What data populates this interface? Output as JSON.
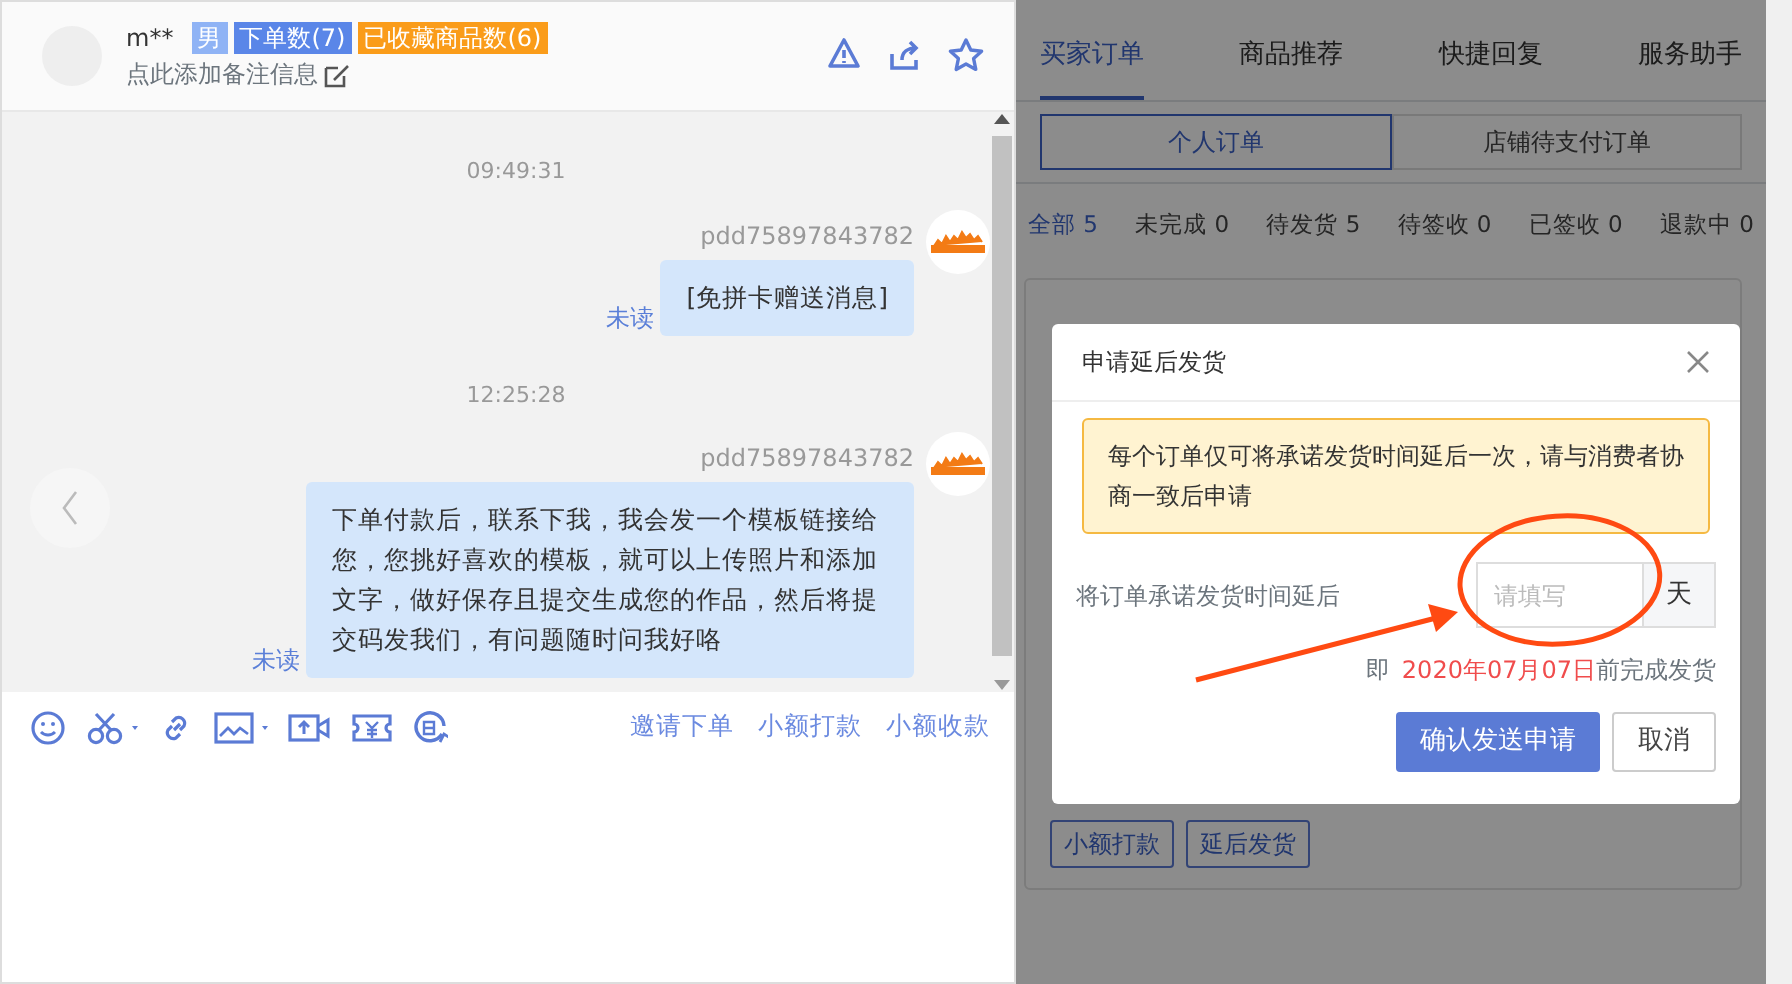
{
  "contact": {
    "name": "m**",
    "tags": [
      {
        "label": "男",
        "color": "#8fb3f5"
      },
      {
        "label": "下单数(7)",
        "color": "#5a86e8"
      },
      {
        "label": "已收藏商品数(6)",
        "color": "#fa9c1a"
      }
    ],
    "note_hint": "点此添加备注信息"
  },
  "messages": [
    {
      "time": "09:49:31",
      "sender": "pdd75897843782",
      "text": "[免拼卡赠送消息]",
      "read_status": "未读"
    },
    {
      "time": "12:25:28",
      "sender": "pdd75897843782",
      "text": "下单付款后，联系下我，我会发一个模板链接给您，您挑好喜欢的模板，就可以上传照片和添加文字，做好保存且提交生成您的作品，然后将提交码发我们，有问题随时问我好咯",
      "read_status": "未读"
    }
  ],
  "toolbar_links": [
    "邀请下单",
    "小额打款",
    "小额收款"
  ],
  "side_tabs": [
    {
      "label": "买家订单",
      "selected": true
    },
    {
      "label": "商品推荐",
      "selected": false
    },
    {
      "label": "快捷回复",
      "selected": false
    },
    {
      "label": "服务助手",
      "selected": false
    }
  ],
  "order_scope": [
    {
      "label": "个人订单",
      "selected": true
    },
    {
      "label": "店铺待支付订单",
      "selected": false
    }
  ],
  "order_filters": [
    {
      "label": "全部 5",
      "selected": true
    },
    {
      "label": "未完成 0",
      "selected": false
    },
    {
      "label": "待发货 5",
      "selected": false
    },
    {
      "label": "待签收 0",
      "selected": false
    },
    {
      "label": "已签收 0",
      "selected": false
    },
    {
      "label": "退款中 0",
      "selected": false
    }
  ],
  "order_actions": [
    "小额打款",
    "延后发货"
  ],
  "dialog": {
    "title": "申请延后发货",
    "notice": "每个订单仅可将承诺发货时间延后一次，请与消费者协商一致后申请",
    "field_label": "将订单承诺发货时间延后",
    "placeholder": "请填写",
    "unit": "天",
    "deadline_prefix": "即",
    "deadline_date": "2020年07月07日",
    "deadline_suffix": "前完成发货",
    "confirm": "确认发送申请",
    "cancel": "取消"
  }
}
